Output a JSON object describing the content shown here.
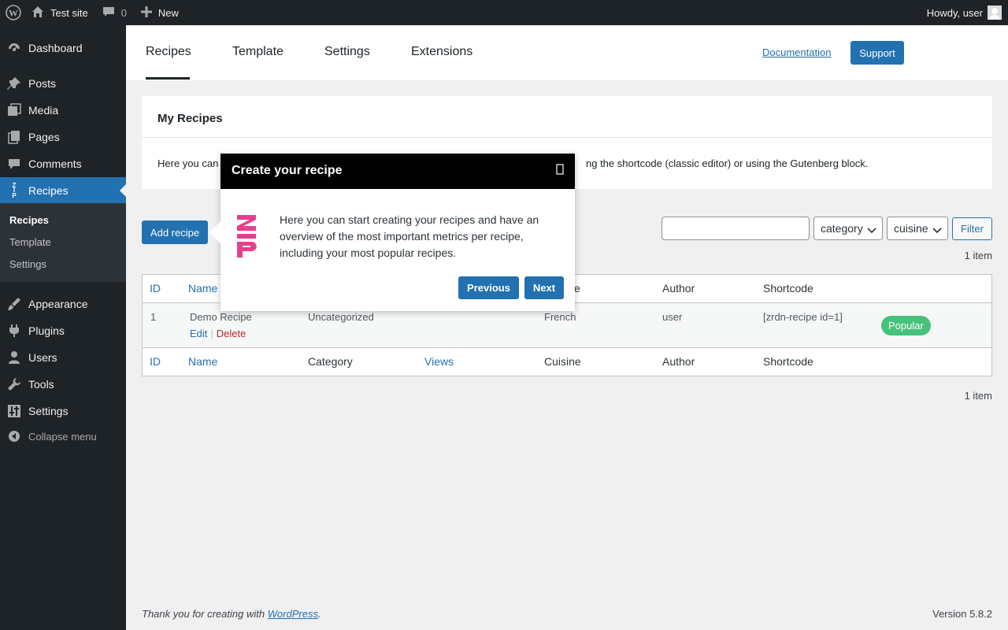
{
  "admin_bar": {
    "site_name": "Test site",
    "comments_count": "0",
    "new_label": "New",
    "greeting": "Howdy, user"
  },
  "sidebar": {
    "items": [
      {
        "label": "Dashboard",
        "icon": "dashboard-icon"
      },
      {
        "label": "Posts",
        "icon": "pushpin-icon"
      },
      {
        "label": "Media",
        "icon": "media-icon"
      },
      {
        "label": "Pages",
        "icon": "pages-icon"
      },
      {
        "label": "Comments",
        "icon": "comment-icon"
      },
      {
        "label": "Recipes",
        "icon": "zip-icon"
      },
      {
        "label": "Appearance",
        "icon": "brush-icon"
      },
      {
        "label": "Plugins",
        "icon": "plugin-icon"
      },
      {
        "label": "Users",
        "icon": "user-icon"
      },
      {
        "label": "Tools",
        "icon": "wrench-icon"
      },
      {
        "label": "Settings",
        "icon": "settings-icon"
      }
    ],
    "submenu": [
      "Recipes",
      "Template",
      "Settings"
    ],
    "collapse_label": "Collapse menu"
  },
  "topnav": {
    "tabs": [
      "Recipes",
      "Template",
      "Settings",
      "Extensions"
    ],
    "documentation": "Documentation",
    "support": "Support"
  },
  "box": {
    "title": "My Recipes",
    "text_left": "Here you can",
    "text_right": "ng the shortcode (classic editor) or using the Gutenberg block."
  },
  "controls": {
    "add_recipe": "Add recipe",
    "search_value": "",
    "category_select": "category",
    "cuisine_select": "cuisine",
    "filter": "Filter",
    "items_count": "1 item"
  },
  "table": {
    "header": {
      "id": "ID",
      "name": "Name",
      "category_visible": "e",
      "author": "Author",
      "shortcode": "Shortcode"
    },
    "footer": {
      "id": "ID",
      "name": "Name",
      "category": "Category",
      "views": "Views",
      "cuisine": "Cuisine",
      "author": "Author",
      "shortcode": "Shortcode"
    },
    "row": {
      "id": "1",
      "name": "Demo Recipe",
      "category": "Uncategorized",
      "cuisine": "French",
      "author": "user",
      "shortcode": "[zrdn-recipe id=1]",
      "badge": "Popular",
      "edit": "Edit",
      "sep": "|",
      "delete": "Delete"
    }
  },
  "tour": {
    "title": "Create your recipe",
    "close_icon": "close-icon",
    "text": "Here you can start creating your recipes and have an overview of the most important metrics per recipe, including your most popular recipes.",
    "previous": "Previous",
    "next": "Next",
    "logo_text": "ZIP",
    "logo_color": "#e83e8c"
  },
  "footer": {
    "thanks_prefix": "Thank you for creating with ",
    "thanks_link": "WordPress",
    "thanks_suffix": ".",
    "version": "Version 5.8.2"
  },
  "colors": {
    "accent": "#2271b1",
    "admin_dark": "#1d2327",
    "badge_green": "#46c27a",
    "delete_red": "#b32d2e"
  }
}
